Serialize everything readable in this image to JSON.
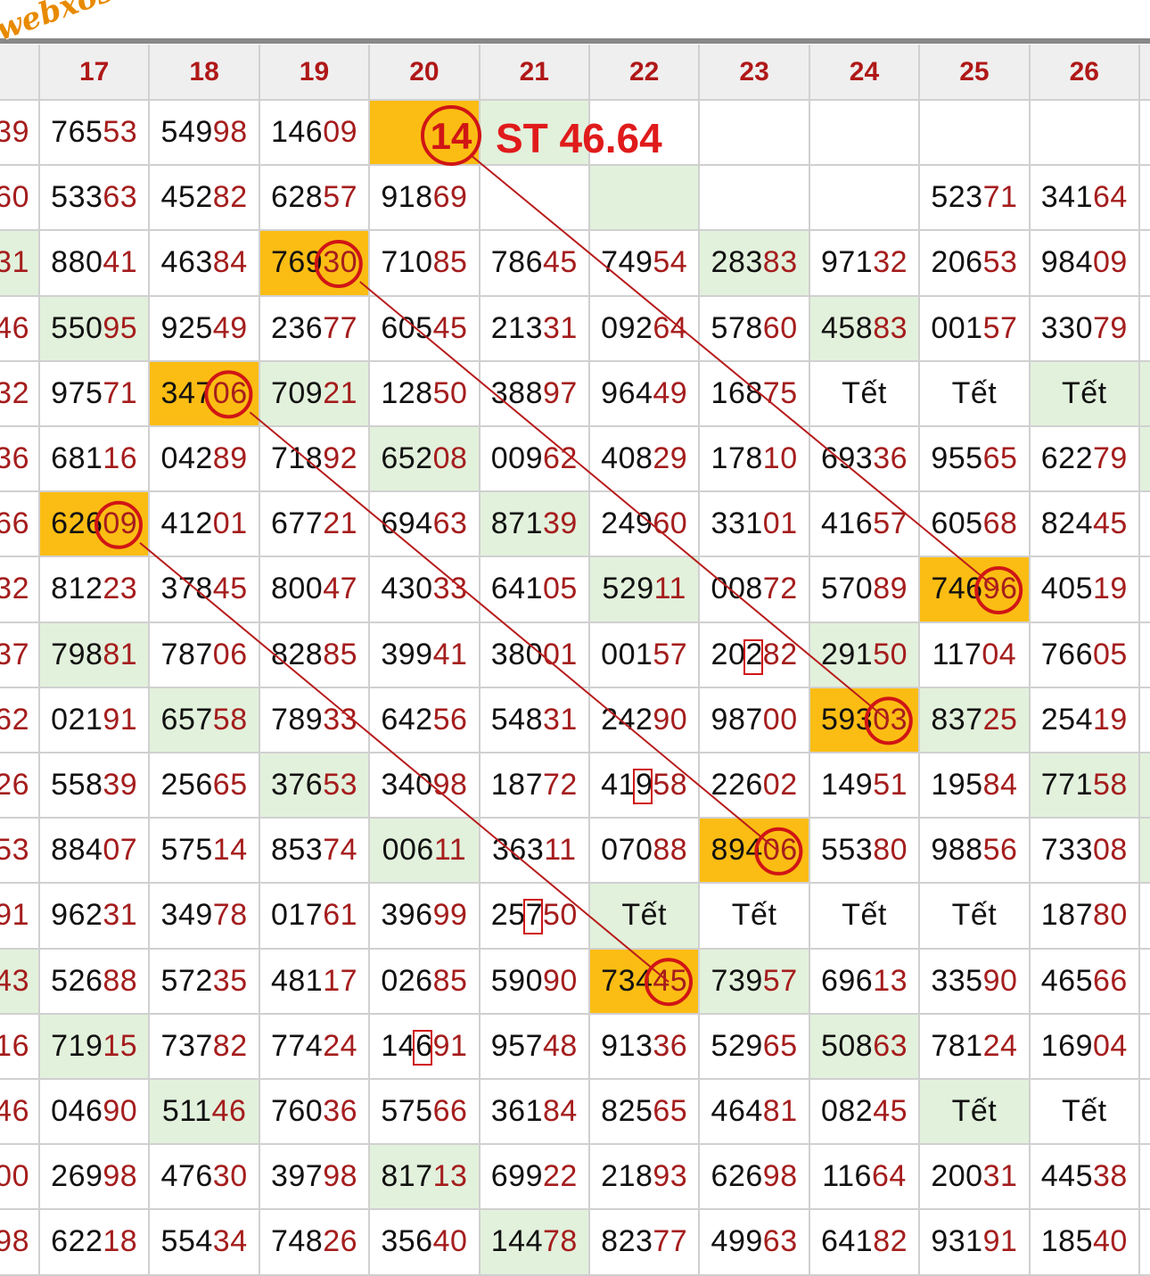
{
  "watermark": "webxoso.net",
  "note": {
    "circled_number": "14",
    "text": "ST 46.64"
  },
  "header": [
    "17",
    "18",
    "19",
    "20",
    "21",
    "22",
    "23",
    "24",
    "25",
    "26"
  ],
  "left_partial": [
    "39",
    "60",
    "31",
    "46",
    "32",
    "36",
    "66",
    "32",
    "37",
    "62",
    "26",
    "53",
    "91",
    "43",
    "16",
    "46",
    "00",
    "98"
  ],
  "rows": [
    [
      [
        "765",
        "53",
        "w"
      ],
      [
        "549",
        "98",
        "w"
      ],
      [
        "146",
        "09",
        "w"
      ],
      [
        "",
        "",
        "o"
      ],
      [
        "",
        "",
        "g"
      ],
      [
        "",
        "",
        "w"
      ],
      [
        "",
        "",
        "w"
      ],
      [
        "",
        "",
        "w"
      ],
      [
        "",
        "",
        "w"
      ],
      [
        "",
        "",
        "w"
      ]
    ],
    [
      [
        "533",
        "63",
        "w"
      ],
      [
        "452",
        "82",
        "w"
      ],
      [
        "628",
        "57",
        "w"
      ],
      [
        "918",
        "69",
        "w"
      ],
      [
        "",
        "",
        "w"
      ],
      [
        "",
        "",
        "g"
      ],
      [
        "",
        "",
        "w"
      ],
      [
        "",
        "",
        "w"
      ],
      [
        "523",
        "71",
        "w"
      ],
      [
        "341",
        "64",
        "w"
      ]
    ],
    [
      [
        "880",
        "41",
        "w"
      ],
      [
        "463",
        "84",
        "w"
      ],
      [
        "769",
        "30",
        "o"
      ],
      [
        "710",
        "85",
        "w"
      ],
      [
        "786",
        "45",
        "w"
      ],
      [
        "749",
        "54",
        "w"
      ],
      [
        "283",
        "83",
        "g"
      ],
      [
        "971",
        "32",
        "w"
      ],
      [
        "206",
        "53",
        "w"
      ],
      [
        "984",
        "09",
        "w"
      ]
    ],
    [
      [
        "550",
        "95",
        "g"
      ],
      [
        "925",
        "49",
        "w"
      ],
      [
        "236",
        "77",
        "w"
      ],
      [
        "605",
        "45",
        "w"
      ],
      [
        "213",
        "31",
        "w"
      ],
      [
        "092",
        "64",
        "w"
      ],
      [
        "578",
        "60",
        "w"
      ],
      [
        "458",
        "83",
        "g"
      ],
      [
        "001",
        "57",
        "w"
      ],
      [
        "330",
        "79",
        "w"
      ]
    ],
    [
      [
        "975",
        "71",
        "w"
      ],
      [
        "347",
        "06",
        "o"
      ],
      [
        "709",
        "21",
        "g"
      ],
      [
        "128",
        "50",
        "w"
      ],
      [
        "388",
        "97",
        "w"
      ],
      [
        "964",
        "49",
        "w"
      ],
      [
        "168",
        "75",
        "w"
      ],
      [
        "Tết",
        "",
        "w"
      ],
      [
        "Tết",
        "",
        "w"
      ],
      [
        "Tết",
        "",
        "g"
      ]
    ],
    [
      [
        "681",
        "16",
        "w"
      ],
      [
        "042",
        "89",
        "w"
      ],
      [
        "718",
        "92",
        "w"
      ],
      [
        "652",
        "08",
        "g"
      ],
      [
        "009",
        "62",
        "w"
      ],
      [
        "408",
        "29",
        "w"
      ],
      [
        "178",
        "10",
        "w"
      ],
      [
        "693",
        "36",
        "w"
      ],
      [
        "955",
        "65",
        "w"
      ],
      [
        "622",
        "79",
        "w"
      ]
    ],
    [
      [
        "626",
        "09",
        "o"
      ],
      [
        "412",
        "01",
        "w"
      ],
      [
        "677",
        "21",
        "w"
      ],
      [
        "694",
        "63",
        "w"
      ],
      [
        "871",
        "39",
        "g"
      ],
      [
        "249",
        "60",
        "w"
      ],
      [
        "331",
        "01",
        "w"
      ],
      [
        "416",
        "57",
        "w"
      ],
      [
        "605",
        "68",
        "w"
      ],
      [
        "824",
        "45",
        "w"
      ]
    ],
    [
      [
        "812",
        "23",
        "w"
      ],
      [
        "378",
        "45",
        "w"
      ],
      [
        "800",
        "47",
        "w"
      ],
      [
        "430",
        "33",
        "w"
      ],
      [
        "641",
        "05",
        "w"
      ],
      [
        "529",
        "11",
        "g"
      ],
      [
        "008",
        "72",
        "w"
      ],
      [
        "570",
        "89",
        "w"
      ],
      [
        "746",
        "96",
        "o"
      ],
      [
        "405",
        "19",
        "w"
      ]
    ],
    [
      [
        "798",
        "81",
        "g"
      ],
      [
        "787",
        "06",
        "w"
      ],
      [
        "828",
        "85",
        "w"
      ],
      [
        "399",
        "41",
        "w"
      ],
      [
        "380",
        "01",
        "w"
      ],
      [
        "001",
        "57",
        "w"
      ],
      [
        "202",
        "82",
        "w"
      ],
      [
        "291",
        "50",
        "g"
      ],
      [
        "117",
        "04",
        "w"
      ],
      [
        "766",
        "05",
        "w"
      ]
    ],
    [
      [
        "021",
        "91",
        "w"
      ],
      [
        "657",
        "58",
        "g"
      ],
      [
        "789",
        "33",
        "w"
      ],
      [
        "642",
        "56",
        "w"
      ],
      [
        "548",
        "31",
        "w"
      ],
      [
        "242",
        "90",
        "w"
      ],
      [
        "987",
        "00",
        "w"
      ],
      [
        "593",
        "03",
        "o"
      ],
      [
        "837",
        "25",
        "g"
      ],
      [
        "254",
        "19",
        "w"
      ]
    ],
    [
      [
        "558",
        "39",
        "w"
      ],
      [
        "256",
        "65",
        "w"
      ],
      [
        "376",
        "53",
        "g"
      ],
      [
        "340",
        "98",
        "w"
      ],
      [
        "187",
        "72",
        "w"
      ],
      [
        "419",
        "58",
        "w"
      ],
      [
        "226",
        "02",
        "w"
      ],
      [
        "149",
        "51",
        "w"
      ],
      [
        "195",
        "84",
        "w"
      ],
      [
        "771",
        "58",
        "g"
      ]
    ],
    [
      [
        "884",
        "07",
        "w"
      ],
      [
        "575",
        "14",
        "w"
      ],
      [
        "853",
        "74",
        "w"
      ],
      [
        "006",
        "11",
        "g"
      ],
      [
        "363",
        "11",
        "w"
      ],
      [
        "070",
        "88",
        "w"
      ],
      [
        "894",
        "06",
        "o"
      ],
      [
        "553",
        "80",
        "w"
      ],
      [
        "988",
        "56",
        "w"
      ],
      [
        "733",
        "08",
        "w"
      ]
    ],
    [
      [
        "962",
        "31",
        "w"
      ],
      [
        "349",
        "78",
        "w"
      ],
      [
        "017",
        "61",
        "w"
      ],
      [
        "396",
        "99",
        "w"
      ],
      [
        "257",
        "50",
        "w"
      ],
      [
        "Tết",
        "",
        "g"
      ],
      [
        "Tết",
        "",
        "w"
      ],
      [
        "Tết",
        "",
        "w"
      ],
      [
        "Tết",
        "",
        "w"
      ],
      [
        "187",
        "80",
        "w"
      ]
    ],
    [
      [
        "526",
        "88",
        "w"
      ],
      [
        "572",
        "35",
        "w"
      ],
      [
        "481",
        "17",
        "w"
      ],
      [
        "026",
        "85",
        "w"
      ],
      [
        "590",
        "90",
        "w"
      ],
      [
        "734",
        "45",
        "o"
      ],
      [
        "739",
        "57",
        "g"
      ],
      [
        "696",
        "13",
        "w"
      ],
      [
        "335",
        "90",
        "w"
      ],
      [
        "465",
        "66",
        "w"
      ]
    ],
    [
      [
        "719",
        "15",
        "g"
      ],
      [
        "737",
        "82",
        "w"
      ],
      [
        "774",
        "24",
        "w"
      ],
      [
        "146",
        "91",
        "w"
      ],
      [
        "957",
        "48",
        "w"
      ],
      [
        "913",
        "36",
        "w"
      ],
      [
        "529",
        "65",
        "w"
      ],
      [
        "508",
        "63",
        "g"
      ],
      [
        "781",
        "24",
        "w"
      ],
      [
        "169",
        "04",
        "w"
      ]
    ],
    [
      [
        "046",
        "90",
        "w"
      ],
      [
        "511",
        "46",
        "g"
      ],
      [
        "760",
        "36",
        "w"
      ],
      [
        "575",
        "66",
        "w"
      ],
      [
        "361",
        "84",
        "w"
      ],
      [
        "825",
        "65",
        "w"
      ],
      [
        "464",
        "81",
        "w"
      ],
      [
        "082",
        "45",
        "w"
      ],
      [
        "Tết",
        "",
        "g"
      ],
      [
        "Tết",
        "",
        "w"
      ]
    ],
    [
      [
        "269",
        "98",
        "w"
      ],
      [
        "476",
        "30",
        "w"
      ],
      [
        "397",
        "98",
        "w"
      ],
      [
        "817",
        "13",
        "g"
      ],
      [
        "699",
        "22",
        "w"
      ],
      [
        "218",
        "93",
        "w"
      ],
      [
        "626",
        "98",
        "w"
      ],
      [
        "116",
        "64",
        "w"
      ],
      [
        "200",
        "31",
        "w"
      ],
      [
        "445",
        "38",
        "w"
      ]
    ],
    [
      [
        "622",
        "18",
        "w"
      ],
      [
        "554",
        "34",
        "w"
      ],
      [
        "748",
        "26",
        "w"
      ],
      [
        "356",
        "40",
        "w"
      ],
      [
        "144",
        "78",
        "g"
      ],
      [
        "823",
        "77",
        "w"
      ],
      [
        "499",
        "63",
        "w"
      ],
      [
        "641",
        "82",
        "w"
      ],
      [
        "931",
        "91",
        "w"
      ],
      [
        "185",
        "40",
        "w"
      ]
    ]
  ],
  "colors": {
    "orange": "#fbbd13",
    "green": "#e2f1dc",
    "red": "#d01515",
    "line": "#b81c1c"
  }
}
